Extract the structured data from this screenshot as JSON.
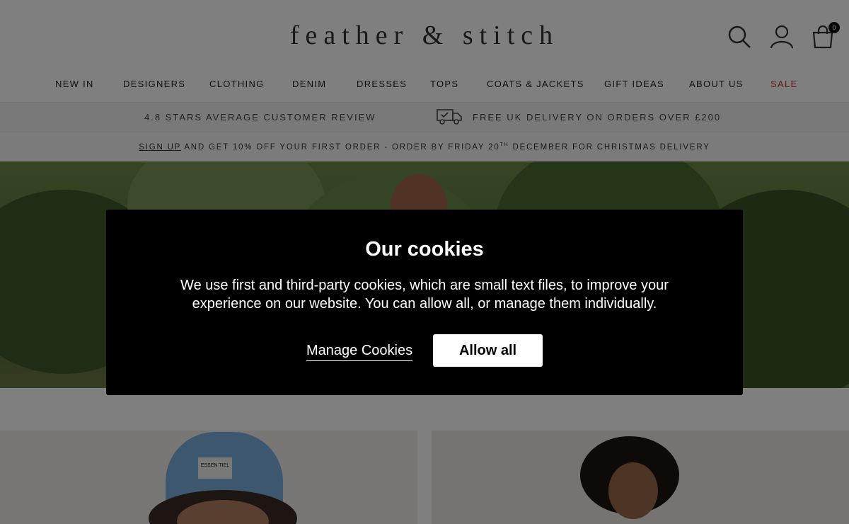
{
  "header": {
    "logo": "feather & stitch",
    "cart_count": "0",
    "icons": [
      "search-icon",
      "account-icon",
      "shopping-bag-icon"
    ]
  },
  "nav": {
    "items": [
      "NEW IN",
      "DESIGNERS",
      "CLOTHING",
      "DENIM",
      "DRESSES",
      "TOPS",
      "COATS & JACKETS",
      "GIFT IDEAS",
      "ABOUT US",
      "SALE"
    ]
  },
  "usp": {
    "reviews": "4.8 STARS AVERAGE CUSTOMER REVIEW",
    "delivery": "FREE UK DELIVERY ON ORDERS OVER £200",
    "delivery_icon": "delivery-truck-icon"
  },
  "promo": {
    "signup": "SIGN UP",
    "text1": " AND GET 10% OFF YOUR FIRST ORDER  -  ORDER BY FRIDAY 20",
    "sup": "TH",
    "text2": " DECEMBER FOR CHRISTMAS DELIVERY"
  },
  "products": {
    "left_label": "ESSEN TIEL"
  },
  "cookie_modal": {
    "title": "Our cookies",
    "text": "We use first and third-party cookies, which are small text files, to improve your experience on our website. You can allow all, or manage them individually.",
    "manage_label": "Manage Cookies",
    "allow_label": "Allow all"
  },
  "colors": {
    "sale": "#c0392b",
    "modal_bg": "#000000",
    "overlay": "rgba(0,0,0,0.5)"
  }
}
